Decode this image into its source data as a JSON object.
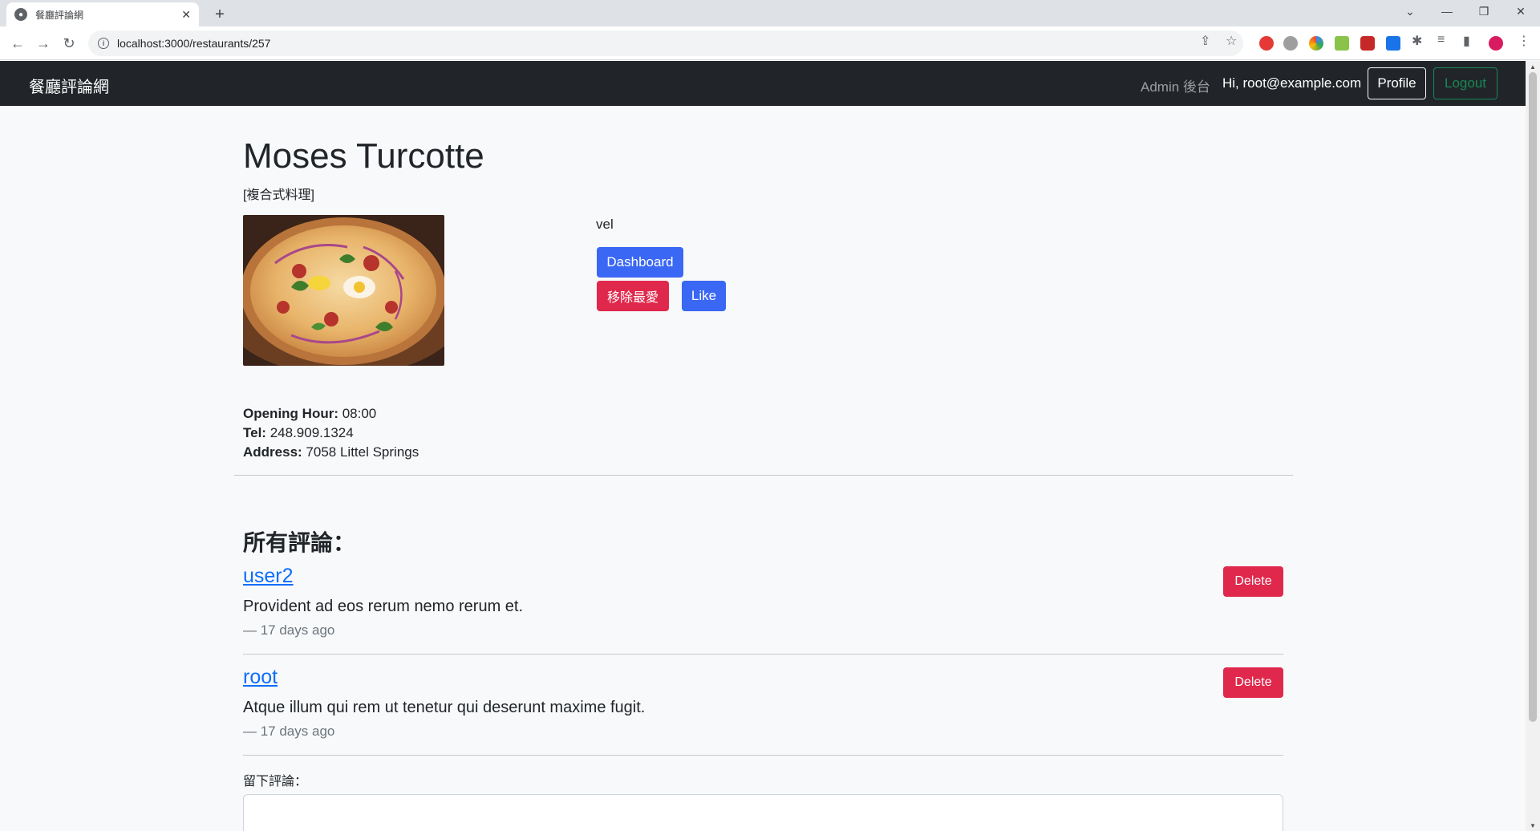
{
  "browser": {
    "tab_title": "餐廳評論網",
    "url": "localhost:3000/restaurants/257",
    "new_tab": "+",
    "tab_close": "✕"
  },
  "navbar": {
    "brand": "餐廳評論網",
    "admin_link": "Admin 後台",
    "greeting": "Hi, root@example.com",
    "profile_label": "Profile",
    "logout_label": "Logout"
  },
  "restaurant": {
    "name": "Moses Turcotte",
    "category": "[複合式料理]",
    "description": "vel",
    "opening_hour_label": "Opening Hour:",
    "opening_hour": "08:00",
    "tel_label": "Tel:",
    "tel": "248.909.1324",
    "address_label": "Address:",
    "address": "7058 Littel Springs"
  },
  "actions": {
    "dashboard_label": "Dashboard",
    "unfavorite_label": "移除最愛",
    "like_label": "Like"
  },
  "reviews": {
    "title": "所有評論：",
    "delete_label": "Delete",
    "items": [
      {
        "user": "user2",
        "text": "Provident ad eos rerum nemo rerum et.",
        "time": "— 17 days ago"
      },
      {
        "user": "root",
        "text": "Atque illum qui rem ut tenetur qui deserunt maxime fugit.",
        "time": "— 17 days ago"
      }
    ]
  },
  "comment_form": {
    "label": "留下評論："
  },
  "colors": {
    "navbar_bg": "#212529",
    "primary": "#3a67f3",
    "danger": "#e0284c",
    "success": "#198754",
    "link": "#0d6efd"
  }
}
